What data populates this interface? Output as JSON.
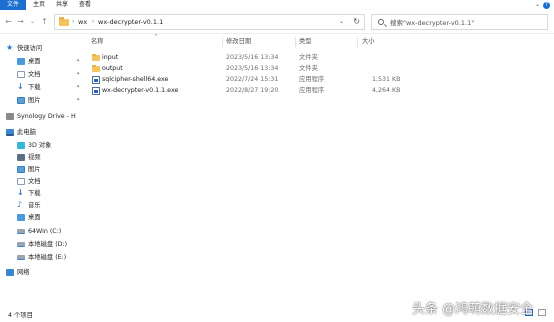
{
  "ribbon": {
    "tabs": [
      "文件",
      "主页",
      "共享",
      "查看"
    ]
  },
  "address": {
    "crumbs": [
      "wx",
      "wx-decrypter-v0.1.1"
    ]
  },
  "search": {
    "placeholder": "搜索\"wx-decrypter-v0.1.1\""
  },
  "nav": {
    "quick_access": "快速访问",
    "quick_items": [
      "桌面",
      "文档",
      "下载",
      "图片"
    ],
    "synology": "Synology Drive - H",
    "this_pc": "此电脑",
    "pc_items": [
      "3D 对象",
      "视频",
      "图片",
      "文档",
      "下载",
      "音乐",
      "桌面"
    ],
    "drives": [
      "64Win (C:)",
      "本地磁盘 (D:)",
      "本地磁盘 (E:)"
    ],
    "network": "网络"
  },
  "columns": {
    "name": "名称",
    "date": "修改日期",
    "type": "类型",
    "size": "大小"
  },
  "files": [
    {
      "name": "input",
      "date": "2023/5/16 13:34",
      "type": "文件夹",
      "size": "",
      "kind": "folder"
    },
    {
      "name": "output",
      "date": "2023/5/16 13:34",
      "type": "文件夹",
      "size": "",
      "kind": "folder"
    },
    {
      "name": "sqlcipher-shell64.exe",
      "date": "2022/7/24 15:31",
      "type": "应用程序",
      "size": "1,531 KB",
      "kind": "exe"
    },
    {
      "name": "wx-decrypter-v0.1.1.exe",
      "date": "2022/8/27 19:20",
      "type": "应用程序",
      "size": "4,264 KB",
      "kind": "exe"
    }
  ],
  "status": {
    "count": "4 个项目"
  },
  "watermark": "头条 @鸿萌数据安全",
  "colors": {
    "accent": "#1a6fd0",
    "folder": "#f2c55c"
  }
}
